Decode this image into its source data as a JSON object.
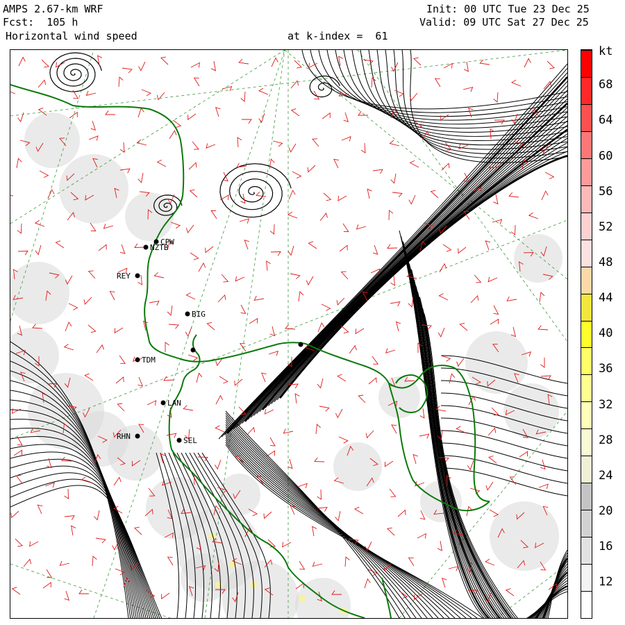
{
  "header": {
    "model": "AMPS 2.67-km WRF",
    "forecast": "Fcst:  105 h",
    "field": "Horizontal wind speed",
    "level": "at k-index =  61",
    "init": "Init: 00 UTC Tue 23 Dec 25",
    "valid": "Valid: 09 UTC Sat 27 Dec 25"
  },
  "colorbar": {
    "unit": "kt",
    "labels": [
      "68",
      "64",
      "60",
      "56",
      "52",
      "48",
      "44",
      "40",
      "36",
      "32",
      "28",
      "24",
      "20",
      "16",
      "12"
    ],
    "colors": [
      "#ffffff",
      "#f4f4f4",
      "#e2e2e2",
      "#d2d2d2",
      "#c4c4c4",
      "#f0f0d6",
      "#fafad2",
      "#ffffb8",
      "#ffff90",
      "#ffff66",
      "#ffff2a",
      "#f4e63c",
      "#ffd8a8",
      "#ffe0e0",
      "#ffd0d0",
      "#ffb8b8",
      "#ff9a9a",
      "#ff7676",
      "#ff5050",
      "#ff2828",
      "#ff0000"
    ]
  },
  "stations": [
    {
      "id": "CPW"
    },
    {
      "id": "NZTB"
    },
    {
      "id": "REY"
    },
    {
      "id": "BIG"
    },
    {
      "id": "TDM"
    },
    {
      "id": "LAN"
    },
    {
      "id": "RHN"
    },
    {
      "id": "SEL"
    }
  ],
  "colors": {
    "coastline": "#0a7a0a",
    "grid": "#3a9a3a",
    "barbs": "#e01818",
    "streamlines": "#000000",
    "terrain_shade": "#d8d8d8"
  }
}
